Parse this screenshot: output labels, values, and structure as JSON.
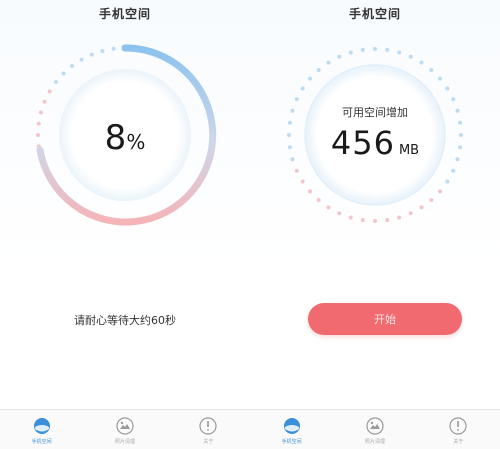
{
  "left_screen": {
    "title": "手机空间",
    "percent_value": "8",
    "percent_sign": "%",
    "progress_fraction": 0.08,
    "wait_text": "请耐心等待大约60秒",
    "tabs": [
      {
        "label": "手机空间",
        "icon": "storage-icon",
        "active": true
      },
      {
        "label": "照片清理",
        "icon": "photo-icon",
        "active": false
      },
      {
        "label": "关于",
        "icon": "info-icon",
        "active": false
      }
    ]
  },
  "right_screen": {
    "title": "手机空间",
    "increase_label": "可用空间增加",
    "increase_value": "456",
    "increase_unit": "MB",
    "start_button": "开始",
    "tabs": [
      {
        "label": "手机空间",
        "icon": "storage-icon",
        "active": true
      },
      {
        "label": "照片清理",
        "icon": "photo-icon",
        "active": false
      },
      {
        "label": "关于",
        "icon": "info-icon",
        "active": false
      }
    ]
  },
  "colors": {
    "accent_blue": "#3a8fd8",
    "arc_blue": "#9fcdf0",
    "arc_red": "#f3b7bb",
    "dot_blue": "#bcdcf2",
    "dot_pink": "#f2c6cb",
    "button_red": "#f06a6f"
  }
}
